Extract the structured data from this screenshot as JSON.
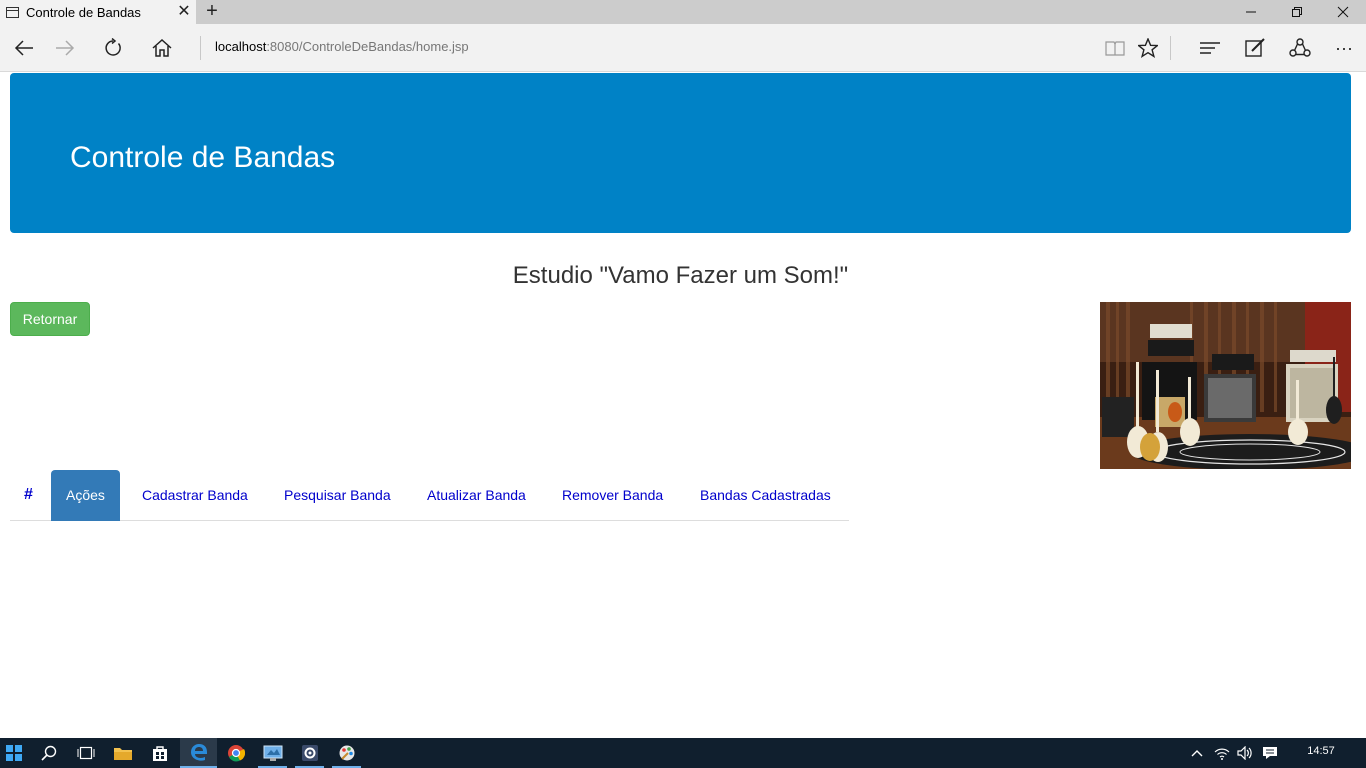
{
  "browser": {
    "tab_title": "Controle de Bandas",
    "tab_close": "✕",
    "new_tab": "+",
    "address_host": "localhost",
    "address_rest": ":8080/ControleDeBandas/home.jsp",
    "more_label": "···"
  },
  "page": {
    "banner_title": "Controle de Bandas",
    "heading": "Estudio \"Vamo Fazer um Som!\"",
    "return_button": "Retornar",
    "tabs": {
      "hash": "#",
      "items": [
        {
          "label": "Ações",
          "active": true
        },
        {
          "label": "Cadastrar Banda"
        },
        {
          "label": "Pesquisar Banda"
        },
        {
          "label": "Atualizar Banda"
        },
        {
          "label": "Remover Banda"
        },
        {
          "label": "Bandas Cadastradas"
        }
      ]
    }
  },
  "taskbar": {
    "clock": "14:57"
  },
  "colors": {
    "banner": "#0082c6",
    "success_button": "#5cb85c",
    "active_tab": "#337ab7",
    "link": "#0000cc",
    "taskbar": "#101f2e"
  }
}
